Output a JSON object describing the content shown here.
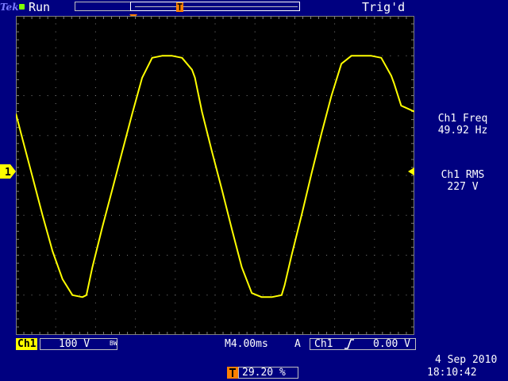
{
  "header": {
    "brand": "Tek",
    "run_state": "Run",
    "trigger_state": "Trig'd"
  },
  "measurements": {
    "freq_label": "Ch1 Freq",
    "freq_value": "49.92 Hz",
    "rms_label": "Ch1 RMS",
    "rms_value": "227 V"
  },
  "channel": {
    "tag": "Ch1",
    "scale": "100 V",
    "bw_limit": "BW",
    "marker": "1"
  },
  "horizontal": {
    "timebase": "M4.00ms",
    "trigger_position": "29.20 %",
    "trigger_position_icon": "T-marker-icon"
  },
  "trigger": {
    "source_label": "A",
    "source": "Ch1",
    "edge_icon": "rising-edge-icon",
    "level": "0.00 V"
  },
  "datetime": {
    "date": "4 Sep  2010",
    "time": "18:10:42"
  },
  "colors": {
    "background": "#000080",
    "screen": "#000000",
    "trace": "#ffff00",
    "trigger_marker": "#ff8000",
    "grid": "#808080"
  },
  "chart_data": {
    "type": "line",
    "x_unit": "ms",
    "y_unit": "V",
    "x_div": 4.0,
    "y_div": 100,
    "divisions": {
      "x": 10,
      "y": 8
    },
    "xlim": [
      -11.68,
      28.32
    ],
    "ylim": [
      -400,
      400
    ],
    "series": [
      {
        "values_x": [
          -11.68,
          -11.0,
          -10.0,
          -9.0,
          -8.0,
          -7.0,
          -6.0,
          -5.0,
          -4.6,
          -4.0,
          -3.0,
          -2.0,
          -1.0,
          0.0,
          1.0,
          2.0,
          3.0,
          4.0,
          5.0,
          6.0,
          6.3,
          7.0,
          8.0,
          9.0,
          10.0,
          11.0,
          12.0,
          13.0,
          14.0,
          15.0,
          15.3,
          16.0,
          17.0,
          18.0,
          19.0,
          20.0,
          21.0,
          22.0,
          23.0,
          24.0,
          25.0,
          26.0,
          26.3,
          27.0,
          28.32
        ],
        "values_y": [
          155,
          90,
          -5,
          -100,
          -190,
          -260,
          -300,
          -305,
          -300,
          -230,
          -130,
          -35,
          60,
          155,
          245,
          295,
          300,
          300,
          295,
          265,
          245,
          160,
          60,
          -35,
          -135,
          -230,
          -295,
          -305,
          -305,
          -300,
          -275,
          -200,
          -100,
          5,
          105,
          200,
          280,
          300,
          300,
          300,
          295,
          250,
          230,
          175,
          160
        ]
      }
    ]
  }
}
